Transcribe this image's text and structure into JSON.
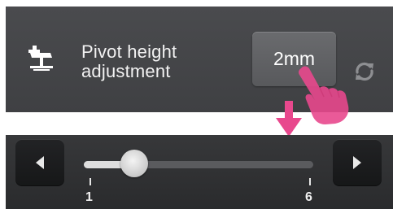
{
  "setting": {
    "label_line1": "Pivot height",
    "label_line2": "adjustment",
    "value": "2mm"
  },
  "slider": {
    "min_label": "1",
    "max_label": "6",
    "min": 1,
    "max": 6,
    "value": 2
  },
  "icons": {
    "setting": "pivot-height-icon",
    "reset": "refresh-icon",
    "pointer": "hand-pointer-icon",
    "indicator": "arrow-down-icon",
    "decrease": "triangle-left-icon",
    "increase": "triangle-right-icon"
  },
  "colors": {
    "panel": "#45464a",
    "slider_panel": "#2f3032",
    "accent_pink": "#e8488d",
    "button": "#626366"
  }
}
